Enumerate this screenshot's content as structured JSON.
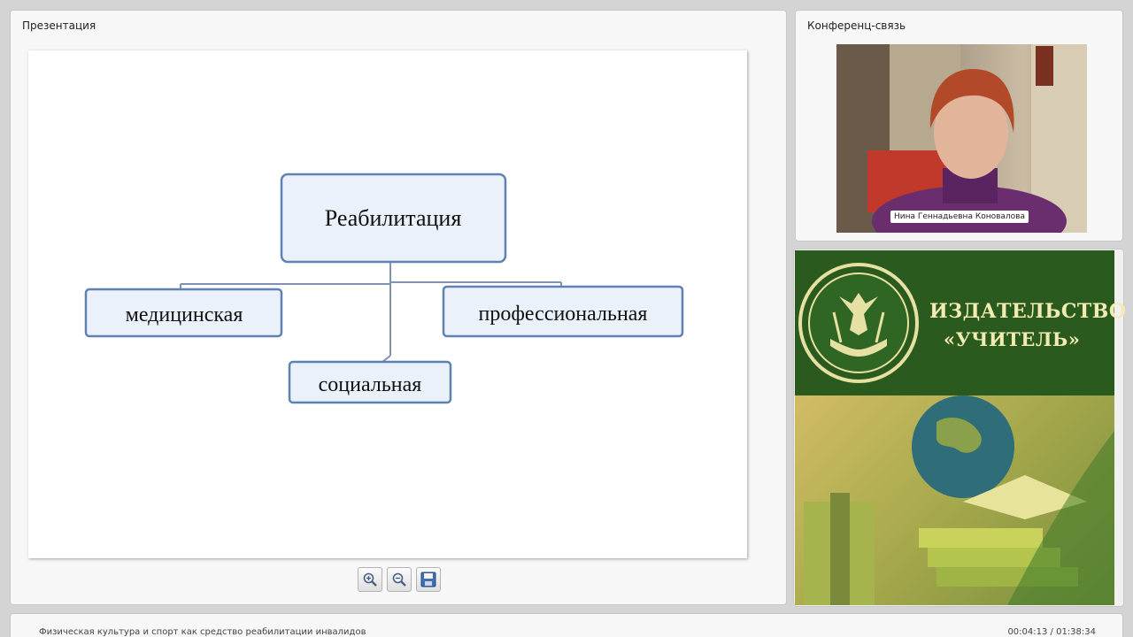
{
  "presentation": {
    "title": "Презентация",
    "slide": {
      "root": "Реабилитация",
      "left": "медицинская",
      "right": "профессиональная",
      "bottom": "социальная"
    },
    "toolbar": {
      "zoom_in": "zoom-in-icon",
      "zoom_out": "zoom-out-icon",
      "save": "save-icon"
    }
  },
  "conference": {
    "title": "Конференц-связь",
    "speaker_name": "Нина Геннадьевна Коновалова"
  },
  "ad": {
    "line1": "ИЗДАТЕЛЬСТВО",
    "line2": "«УЧИТЕЛЬ»",
    "brand_green": "#2a5a1e",
    "logo_color": "#e6e0a2"
  },
  "footer": {
    "course_title": "Физическая культура и спорт как средство реабилитации инвалидов",
    "timecode": "00:04:13 / 01:38:34"
  }
}
